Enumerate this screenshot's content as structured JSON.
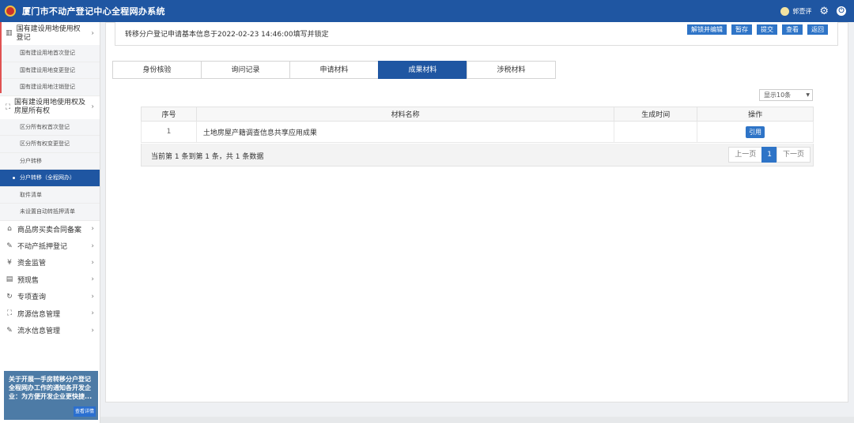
{
  "app": {
    "title": "厦门市不动产登记中心全程网办系统",
    "user": "郭壹评"
  },
  "sidebar": {
    "group1": {
      "label": "国有建设用地使用权登记",
      "items": [
        "国有建设用地首次登记",
        "国有建设用地变更登记",
        "国有建设用地注销登记"
      ]
    },
    "group2": {
      "label": "国有建设用地使用权及房屋所有权",
      "items": [
        "区分所有权首次登记",
        "区分所有权变更登记",
        "分户转移",
        "分户转移（全程网办）",
        "取件清单",
        "未设置自动转抵押清单"
      ]
    },
    "menus": [
      {
        "label": "商品房买卖合同备案",
        "icon": "home-icon"
      },
      {
        "label": "不动产抵押登记",
        "icon": "edit-icon"
      },
      {
        "label": "资金监管",
        "icon": "money-icon"
      },
      {
        "label": "预现售",
        "icon": "presale-icon"
      },
      {
        "label": "专项查询",
        "icon": "query-icon"
      },
      {
        "label": "房源信息管理",
        "icon": "house-info-icon"
      },
      {
        "label": "流水信息管理",
        "icon": "flow-icon"
      }
    ],
    "notice": {
      "text": "关于开展一手房转移分户登记全程网办工作的通知各开发企业：为方便开发企业更快捷...",
      "more": "查看详情"
    }
  },
  "header": {
    "text": "转移分户登记申请基本信息于2022-02-23 14:46:00填写并锁定",
    "buttons": [
      "解锁并编辑",
      "暂存",
      "提交",
      "查看",
      "返回"
    ]
  },
  "tabs": [
    "身份核验",
    "询问记录",
    "申请材料",
    "成果材料",
    "涉税材料"
  ],
  "active_tab": "成果材料",
  "page_size": "显示10条",
  "table": {
    "headers": [
      "序号",
      "材料名称",
      "生成时间",
      "操作"
    ],
    "rows": [
      {
        "num": "1",
        "name": "土地房屋产籍调查信息共享应用成果",
        "time": "",
        "action": "引用"
      }
    ]
  },
  "footer": {
    "text": "当前第 1 条到第 1 条，共 1 条数据",
    "prev": "上一页",
    "page": "1",
    "next": "下一页"
  }
}
